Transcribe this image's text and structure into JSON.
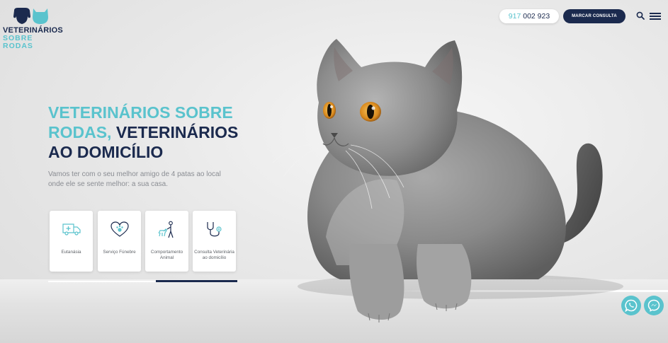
{
  "brand": {
    "name_line1": "VETERINÁRIOS",
    "name_line2": "SOBRE RODAS",
    "colors": {
      "navy": "#1b2a4e",
      "teal": "#5ac3cd"
    }
  },
  "header": {
    "phone_prefix": "917",
    "phone_rest": "002 923",
    "cta_label": "MARCAR CONSULTA",
    "search_icon": "search-icon",
    "menu_icon": "hamburger-menu-icon"
  },
  "hero": {
    "headline_accent": "VETERINÁRIOS SOBRE RODAS,",
    "headline_rest": "VETERINÁRIOS AO DOMICÍLIO",
    "subtitle": "Vamos ter com o seu melhor amigo de 4 patas ao local onde ele se sente melhor: a sua casa."
  },
  "services": [
    {
      "label": "Eutanásia",
      "icon": "ambulance-icon"
    },
    {
      "label": "Serviço Fúnebre",
      "icon": "heart-paw-icon"
    },
    {
      "label": "Comportamento Animal",
      "icon": "dog-walker-icon"
    },
    {
      "label": "Consulta Veterinária ao domicílio",
      "icon": "stethoscope-icon"
    }
  ],
  "floating": {
    "whatsapp_icon": "whatsapp-icon",
    "messenger_icon": "messenger-icon"
  }
}
